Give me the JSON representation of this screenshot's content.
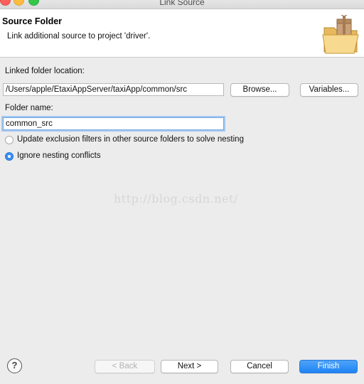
{
  "window": {
    "title": "Link Source"
  },
  "banner": {
    "title": "Source Folder",
    "description": "Link additional source to project 'driver'.",
    "icon": "folder-package-icon"
  },
  "linked_location": {
    "label": "Linked folder location:",
    "value": "/Users/apple/EtaxiAppServer/taxiApp/common/src",
    "browse_label": "Browse...",
    "variables_label": "Variables..."
  },
  "folder_name": {
    "label": "Folder name:",
    "value": "common_src"
  },
  "options": {
    "update_exclusion": "Update exclusion filters in other source folders to solve nesting",
    "ignore_nesting": "Ignore nesting conflicts",
    "selected": "ignore_nesting"
  },
  "watermark": "http://blog.csdn.net/",
  "footer": {
    "help_icon": "help-icon",
    "back_label": "< Back",
    "next_label": "Next >",
    "cancel_label": "Cancel",
    "finish_label": "Finish"
  },
  "colors": {
    "accent": "#1e84f5",
    "window_bg": "#ececec"
  }
}
